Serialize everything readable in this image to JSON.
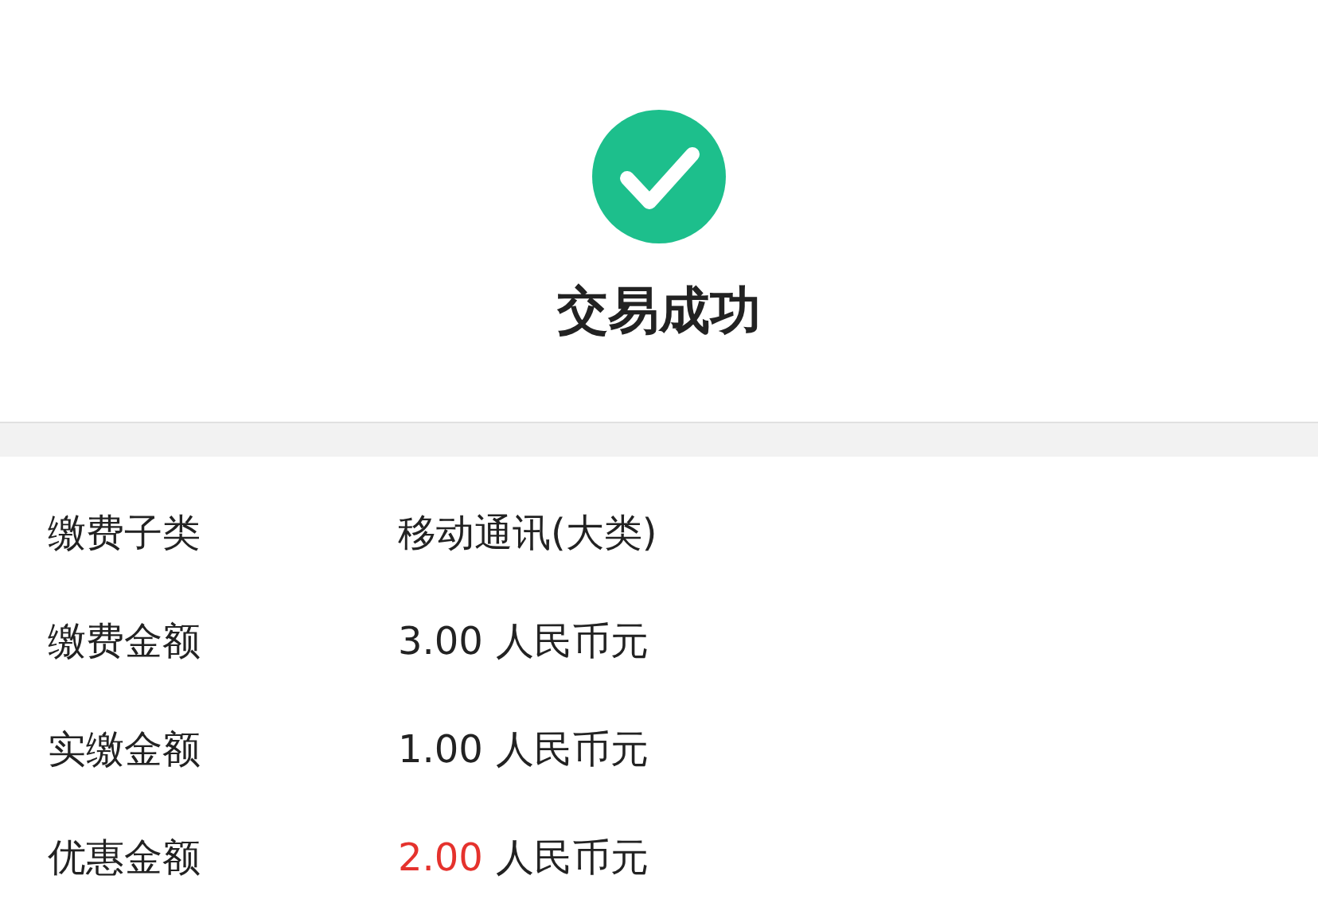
{
  "result": {
    "title": "交易成功"
  },
  "details": [
    {
      "kind": "text",
      "label": "缴费子类",
      "value": "移动通讯(大类)"
    },
    {
      "kind": "amount",
      "label": "缴费金额",
      "amount": "3.00",
      "unit": "人民币元",
      "highlighted": false
    },
    {
      "kind": "amount",
      "label": "实缴金额",
      "amount": "1.00",
      "unit": "人民币元",
      "highlighted": false
    },
    {
      "kind": "amount",
      "label": "优惠金额",
      "amount": "2.00",
      "unit": "人民币元",
      "highlighted": true
    }
  ]
}
